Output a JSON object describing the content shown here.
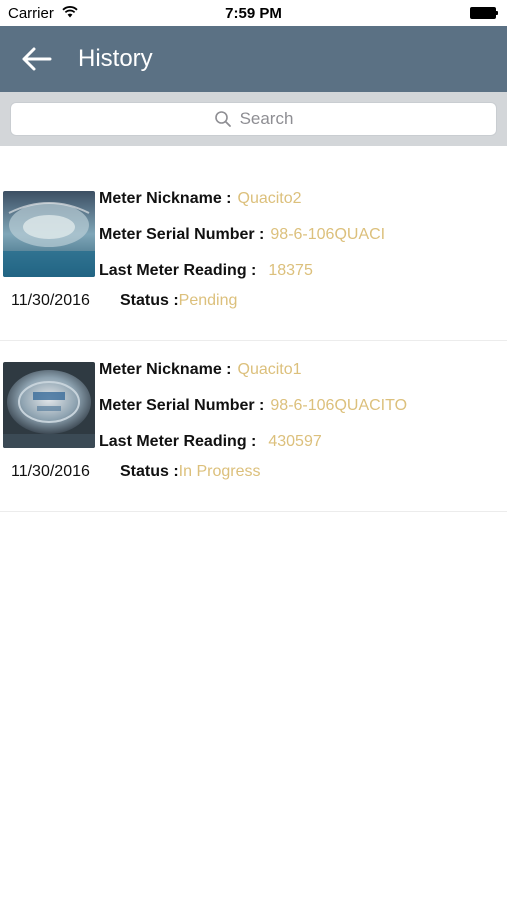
{
  "status_bar": {
    "carrier": "Carrier",
    "time": "7:59 PM"
  },
  "nav": {
    "title": "History"
  },
  "search": {
    "placeholder": "Search"
  },
  "labels": {
    "nickname": "Meter Nickname :",
    "serial": "Meter Serial Number :",
    "reading": "Last Meter Reading :",
    "status": "Status :"
  },
  "items": [
    {
      "nickname": "Quacito2",
      "serial": "98-6-106QUACI",
      "reading": "18375",
      "date": "11/30/2016",
      "status": "Pending"
    },
    {
      "nickname": "Quacito1",
      "serial": "98-6-106QUACITO",
      "reading": "430597",
      "date": "11/30/2016",
      "status": "In Progress"
    }
  ],
  "colors": {
    "nav_bg": "#5b7184",
    "search_bg": "#d3d6d9",
    "value_text": "#dcc07c"
  }
}
